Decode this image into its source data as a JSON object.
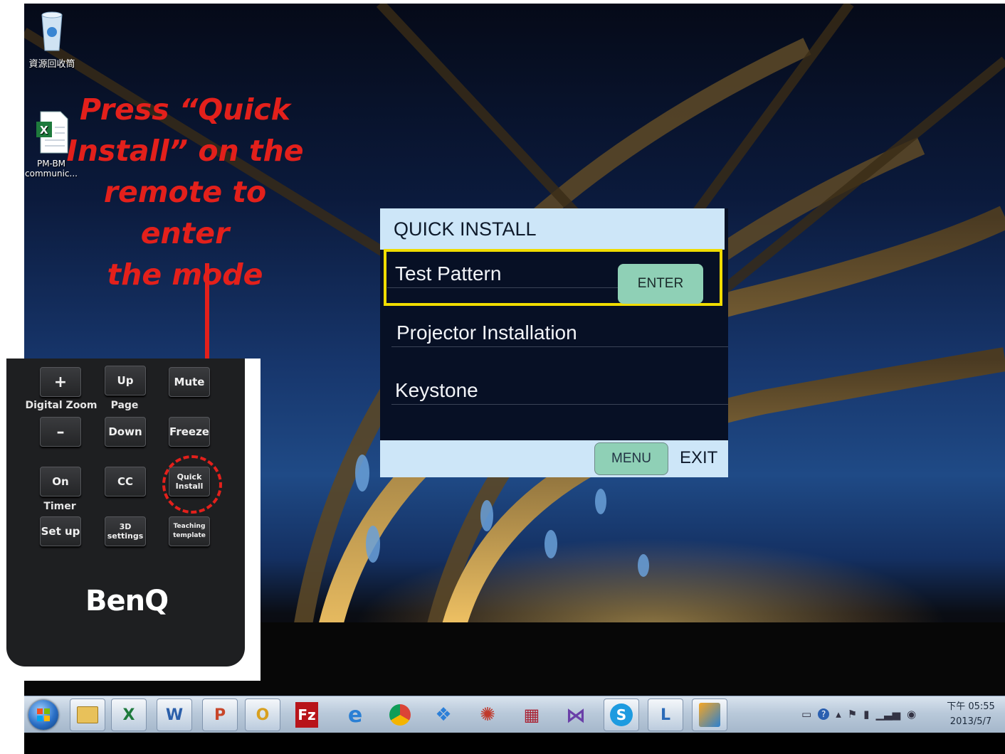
{
  "desktop": {
    "icons": [
      {
        "label": "資源回收筒",
        "icon": "recycle-bin-icon"
      },
      {
        "label": "PM-BM communic...",
        "icon": "excel-file-icon"
      }
    ]
  },
  "annotation": {
    "lines": [
      "Press “Quick",
      "Install” on the",
      "remote to enter",
      "the mode"
    ],
    "color": "#e3201b"
  },
  "remote": {
    "buttons": {
      "plus": "+",
      "minus": "–",
      "up": "Up",
      "down": "Down",
      "mute": "Mute",
      "freeze": "Freeze",
      "on": "On",
      "cc": "CC",
      "quick_install": "Quick Install",
      "setup": "Set up",
      "settings_3d": "3D settings",
      "teaching": "Teaching template"
    },
    "labels": {
      "digital_zoom": "Digital Zoom",
      "page": "Page",
      "timer": "Timer"
    },
    "brand": "BenQ"
  },
  "osd": {
    "title": "QUICK INSTALL",
    "items": [
      {
        "label": "Test Pattern",
        "selected": true
      },
      {
        "label": "Projector Installation",
        "selected": false
      },
      {
        "label": "Keystone",
        "selected": false
      }
    ],
    "enter_label": "ENTER",
    "menu_label": "MENU",
    "exit_label": "EXIT",
    "highlight_color": "#f0dc00",
    "button_color": "#8fd0b6"
  },
  "taskbar": {
    "apps": [
      "start-orb",
      "file-explorer-icon",
      "excel-icon",
      "word-icon",
      "powerpoint-icon",
      "outlook-icon",
      "filezilla-icon",
      "internet-explorer-icon",
      "chrome-icon",
      "dropbox-icon",
      "picasa-icon",
      "calculator-chart-icon",
      "visual-studio-icon",
      "skype-icon",
      "lync-icon",
      "paint-icon"
    ],
    "clock": {
      "time": "下午 05:55",
      "date": "2013/5/7"
    }
  }
}
